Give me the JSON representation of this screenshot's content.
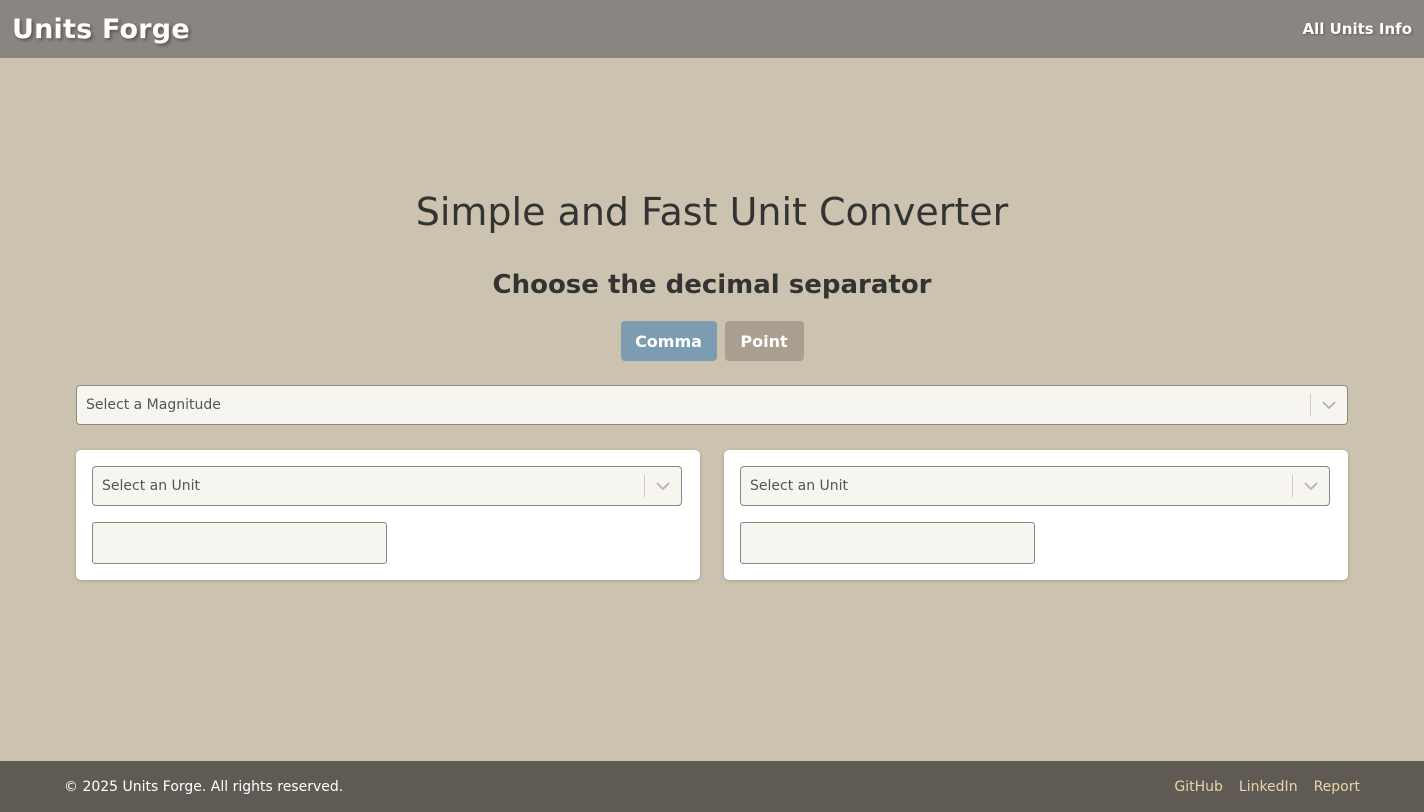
{
  "navbar": {
    "brand": "Units Forge",
    "link_all_units": "All Units Info"
  },
  "main": {
    "title": "Simple and Fast Unit Converter",
    "subtitle": "Choose the decimal separator",
    "separator_buttons": {
      "comma": "Comma",
      "point": "Point"
    },
    "magnitude_select": {
      "placeholder": "Select a Magnitude"
    },
    "converter_left": {
      "unit_placeholder": "Select an Unit",
      "value": ""
    },
    "converter_right": {
      "unit_placeholder": "Select an Unit",
      "value": ""
    }
  },
  "footer": {
    "copyright": "© 2025 Units Forge. All rights reserved.",
    "links": [
      "GitHub",
      "LinkedIn",
      "Report"
    ]
  },
  "colors": {
    "background": "#cbc3af",
    "navbar": "#8a8580",
    "footer": "#5f5a53",
    "comma_button": "#7c9db1",
    "point_button": "#a89f90",
    "footer_link": "#e6d6a8"
  },
  "icons": {
    "select_indicator": "chevron-down-icon"
  }
}
